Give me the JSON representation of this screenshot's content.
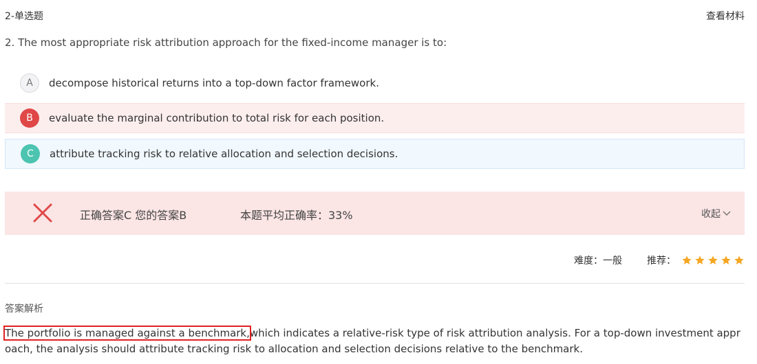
{
  "header": {
    "question_type": "2-单选题",
    "view_material": "查看材料"
  },
  "question": {
    "text": "2. The most appropriate risk attribution approach for the fixed-income manager is to:"
  },
  "options": [
    {
      "letter": "A",
      "text": "decompose historical returns into a top-down factor framework.",
      "state": "neutral"
    },
    {
      "letter": "B",
      "text": "evaluate the marginal contribution to total risk for each position.",
      "state": "selected-wrong"
    },
    {
      "letter": "C",
      "text": "attribute tracking risk to relative allocation and selection decisions.",
      "state": "correct"
    }
  ],
  "result": {
    "answer_line": "正确答案C 您的答案B",
    "rate_line": "本题平均正确率：33%",
    "collapse_label": "收起"
  },
  "meta": {
    "difficulty_label": "难度：一般",
    "recommend_label": "推荐：",
    "stars": 5
  },
  "analysis": {
    "title": "答案解析",
    "highlighted": "The portfolio is managed against a benchmark,",
    "rest": "which indicates a relative-risk type of risk attribution analysis. For a top-down investment approach, the analysis should attribute tracking risk to allocation and selection decisions relative to the benchmark."
  },
  "colors": {
    "wrong": "#e04848",
    "correct": "#4cc4b0",
    "star": "#f5a623",
    "highlight_border": "#e02020"
  }
}
